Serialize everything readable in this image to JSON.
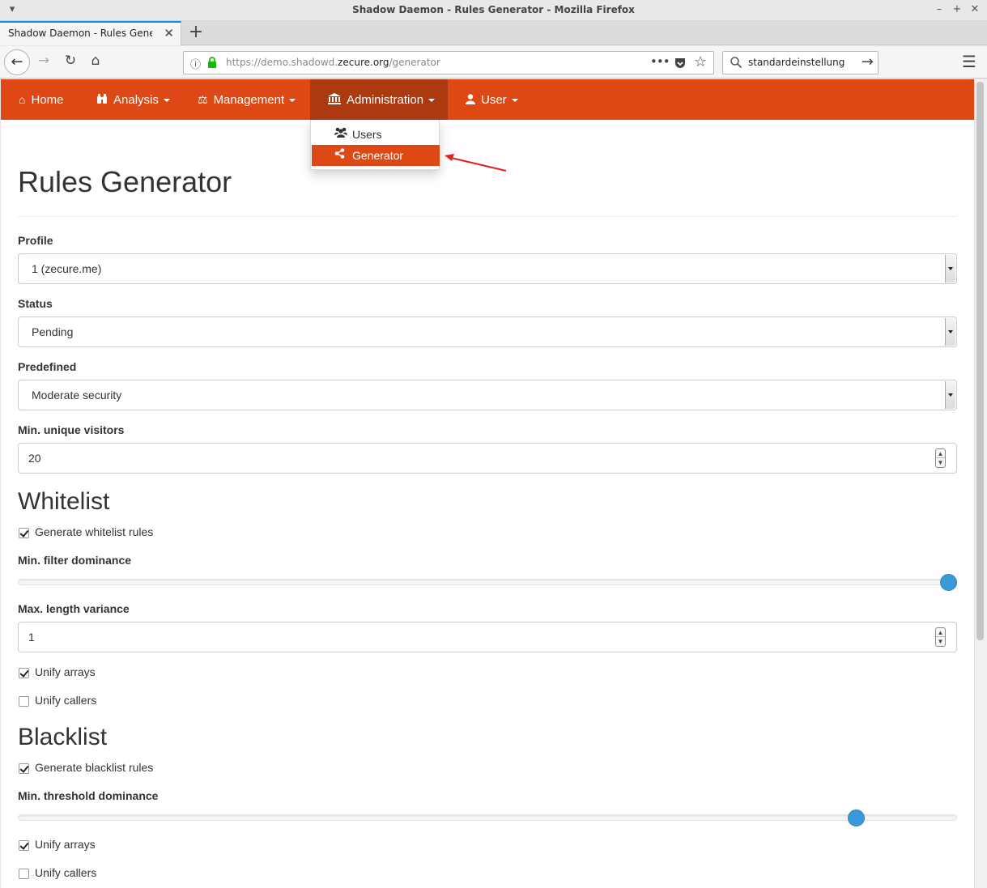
{
  "window": {
    "title": "Shadow Daemon - Rules Generator - Mozilla Firefox"
  },
  "browser": {
    "tab_title": "Shadow Daemon - Rules Generator",
    "url_prefix": "https://demo.shadowd.",
    "url_domain": "zecure.org",
    "url_path": "/generator",
    "search_value": "standardeinstellung"
  },
  "nav": {
    "items": [
      {
        "label": "Home",
        "icon": "home-icon"
      },
      {
        "label": "Analysis",
        "icon": "binoculars-icon"
      },
      {
        "label": "Management",
        "icon": "balance-scale-icon"
      },
      {
        "label": "Administration",
        "icon": "bank-icon"
      },
      {
        "label": "User",
        "icon": "user-icon"
      }
    ],
    "active": "Administration",
    "brand_color": "#dd4814",
    "active_color": "#ad3910"
  },
  "dropdown": {
    "items": [
      {
        "label": "Users",
        "icon": "users-icon"
      },
      {
        "label": "Generator",
        "icon": "share-icon",
        "active": true
      }
    ]
  },
  "page": {
    "title": "Rules Generator"
  },
  "form": {
    "profile": {
      "label": "Profile",
      "value": "1 (zecure.me)"
    },
    "status": {
      "label": "Status",
      "value": "Pending"
    },
    "predefined": {
      "label": "Predefined",
      "value": "Moderate security"
    },
    "min_unique_visitors": {
      "label": "Min. unique visitors",
      "value": "20"
    }
  },
  "whitelist": {
    "heading": "Whitelist",
    "generate": {
      "label": "Generate whitelist rules",
      "checked": true
    },
    "min_filter_dominance": {
      "label": "Min. filter dominance",
      "level": 1.0
    },
    "max_length_variance": {
      "label": "Max. length variance",
      "value": "1"
    },
    "unify_arrays": {
      "label": "Unify arrays",
      "checked": true
    },
    "unify_callers": {
      "label": "Unify callers",
      "checked": false
    }
  },
  "blacklist": {
    "heading": "Blacklist",
    "generate": {
      "label": "Generate blacklist rules",
      "checked": true
    },
    "min_threshold_dominance": {
      "label": "Min. threshold dominance",
      "level": 0.9
    },
    "unify_arrays": {
      "label": "Unify arrays",
      "checked": true
    },
    "unify_callers": {
      "label": "Unify callers",
      "checked": false
    }
  },
  "colors": {
    "slider_handle": "#3a9ad9",
    "annotation_arrow": "#e2231a"
  }
}
